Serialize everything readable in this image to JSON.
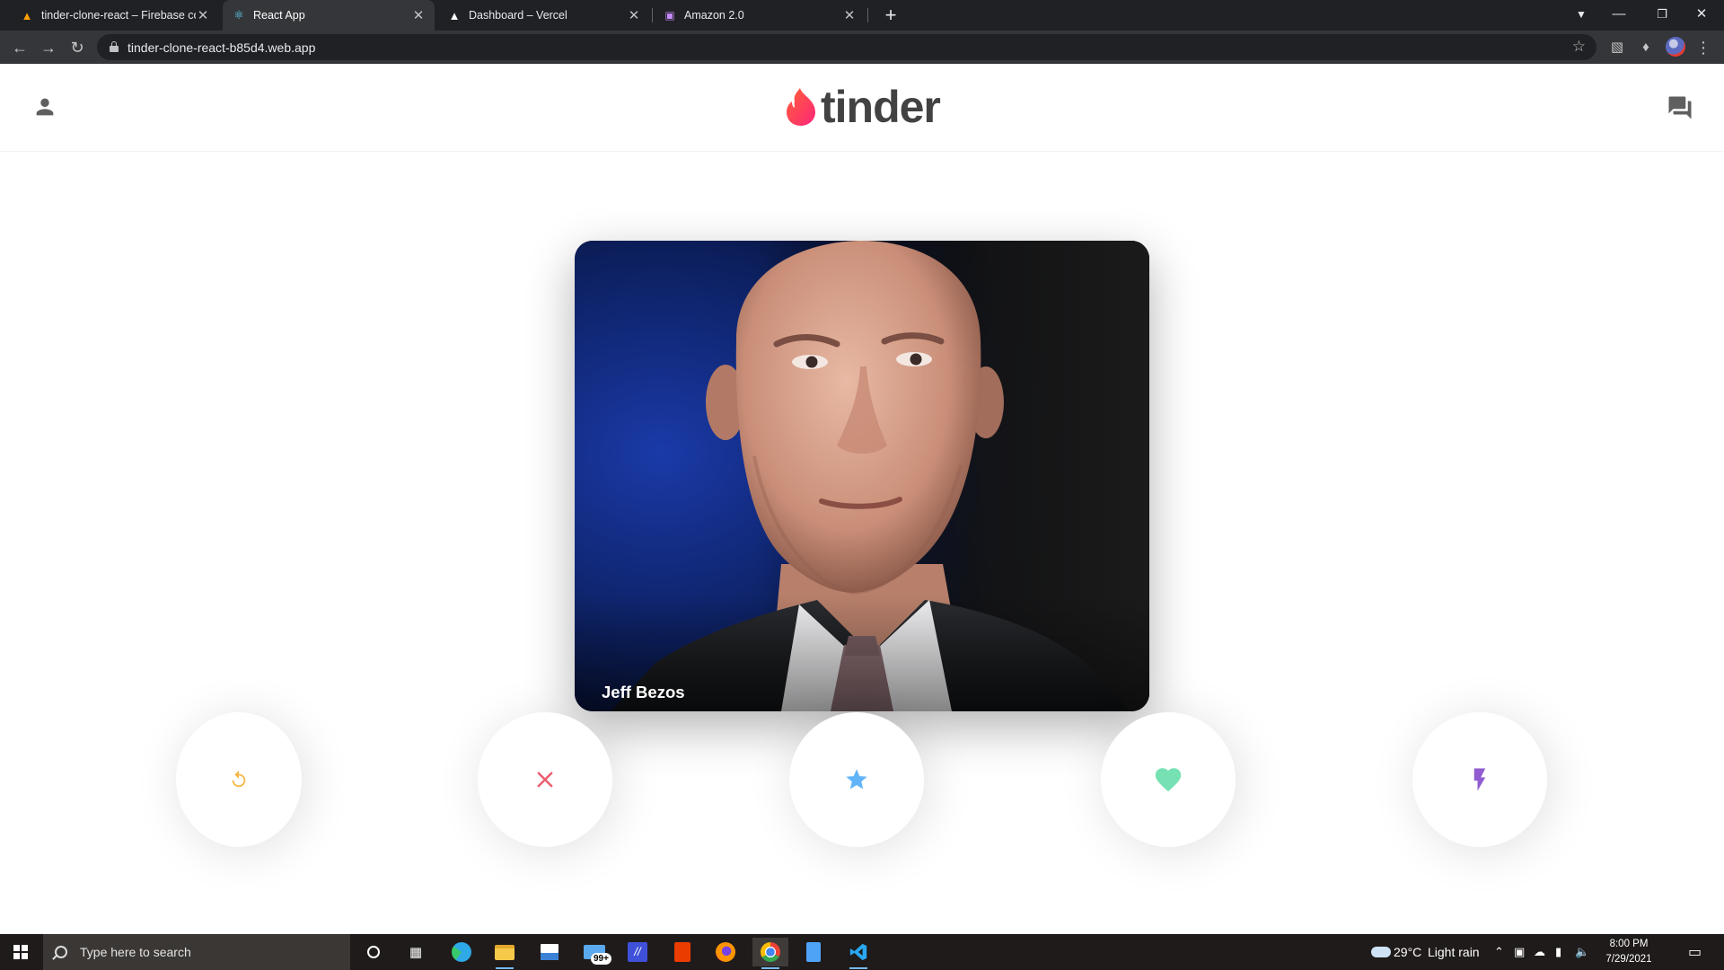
{
  "browser": {
    "tabs": [
      {
        "title": "tinder-clone-react – Firebase con",
        "favicon": "firebase-icon",
        "active": false
      },
      {
        "title": "React App",
        "favicon": "react-icon",
        "active": true
      },
      {
        "title": "Dashboard – Vercel",
        "favicon": "vercel-icon",
        "active": false
      },
      {
        "title": "Amazon 2.0",
        "favicon": "amazon-clone-icon",
        "active": false
      }
    ],
    "url": "tinder-clone-react-b85d4.web.app"
  },
  "app": {
    "logo_text": "tinder",
    "brand_color": "#fe3c72",
    "header_left_icon": "person-icon",
    "header_right_icon": "forum-icon"
  },
  "card": {
    "name": "Jeff Bezos"
  },
  "buttons": [
    {
      "id": "replay",
      "icon": "replay-icon",
      "color": "#f5b748"
    },
    {
      "id": "close",
      "icon": "close-icon",
      "color": "#ec5e6f"
    },
    {
      "id": "star",
      "icon": "star-icon",
      "color": "#62b4f9"
    },
    {
      "id": "favorite",
      "icon": "heart-icon",
      "color": "#76e2b3"
    },
    {
      "id": "flash",
      "icon": "flash-icon",
      "color": "#915dd1"
    }
  ],
  "taskbar": {
    "search_placeholder": "Type here to search",
    "mail_badge": "99+",
    "weather_temp": "29°C",
    "weather_text": "Light rain",
    "time": "8:00 PM",
    "date": "7/29/2021"
  }
}
